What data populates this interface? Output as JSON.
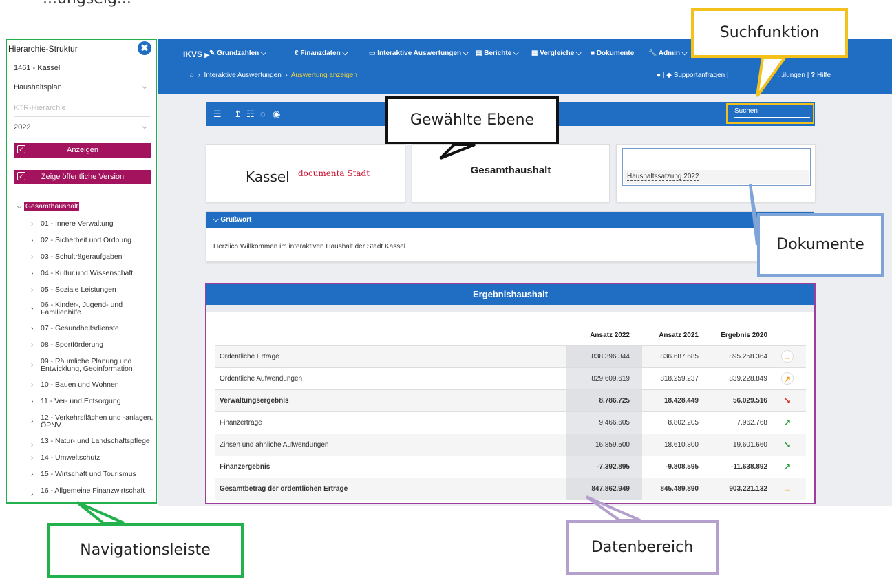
{
  "top_text": "...ungseig...",
  "nav": {
    "title": "Hierarchie-Struktur",
    "close_icon": "close-icon",
    "location": "1461 - Kassel",
    "plan_select": "Haushaltsplan",
    "ktr_placeholder": "KTR-Hierarchie",
    "year_select": "2022",
    "show_button": "Anzeigen",
    "public_button": "Zeige öffentliche Version",
    "tree_root": "Gesamthaushalt",
    "tree_items": [
      "01 - Innere Verwaltung",
      "02 - Sicherheit und Ordnung",
      "03 - Schulträgeraufgaben",
      "04 - Kultur und Wissenschaft",
      "05 - Soziale Leistungen",
      "06 - Kinder-, Jugend- und Familienhilfe",
      "07 - Gesundheitsdienste",
      "08 - Sportförderung",
      "09 - Räumliche Planung und Entwicklung, Geoinformation",
      "10 - Bauen und Wohnen",
      "11 - Ver- und Entsorgung",
      "12 - Verkehrsflächen und -anlagen, ÖPNV",
      "13 - Natur- und Landschaftspflege",
      "14 - Umweltschutz",
      "15 - Wirtschaft und Tourismus",
      "16 - Allgemeine Finanzwirtschaft"
    ]
  },
  "header": {
    "logo": "IKVS",
    "menu": [
      "Grundzahlen",
      "Finanzdaten",
      "Interaktive Auswertungen",
      "Berichte",
      "Vergleiche",
      "Dokumente",
      "Admin"
    ],
    "breadcrumb": [
      "Interaktive Auswertungen",
      "Auswertung anzeigen"
    ],
    "right_links": [
      "Supportanfragen",
      "...ilungen",
      "Hilfe"
    ],
    "search_placeholder": "Suchen"
  },
  "cards": {
    "city": "Kassel",
    "city_tagline": "documenta Stadt",
    "level": "Gesamthaushalt",
    "document_link": "Haushaltssatzung 2022"
  },
  "greeting": {
    "title": "Grußwort",
    "text": "Herzlich Willkommen im interaktiven Haushalt der Stadt Kassel"
  },
  "results": {
    "title": "Ergebnishaushalt",
    "columns": [
      "Ansatz 2022",
      "Ansatz 2021",
      "Ergebnis 2020"
    ],
    "rows": [
      {
        "label": "Ordentliche Erträge",
        "v1": "838.396.344",
        "v2": "836.687.685",
        "v3": "895.258.364",
        "trend": "→",
        "color": "#f39c12",
        "link": true,
        "bold": false,
        "circle": true
      },
      {
        "label": "Ordentliche Aufwendungen",
        "v1": "829.609.619",
        "v2": "818.259.237",
        "v3": "839.228.849",
        "trend": "↗",
        "color": "#f39c12",
        "link": true,
        "bold": false,
        "circle": true
      },
      {
        "label": "Verwaltungsergebnis",
        "v1": "8.786.725",
        "v2": "18.428.449",
        "v3": "56.029.516",
        "trend": "↘",
        "color": "#d9261c",
        "link": false,
        "bold": true,
        "circle": false
      },
      {
        "label": "Finanzerträge",
        "v1": "9.466.605",
        "v2": "8.802.205",
        "v3": "7.962.768",
        "trend": "↗",
        "color": "#2e9e3e",
        "link": false,
        "bold": false,
        "circle": false
      },
      {
        "label": "Zinsen und ähnliche Aufwendungen",
        "v1": "16.859.500",
        "v2": "18.610.800",
        "v3": "19.601.660",
        "trend": "↘",
        "color": "#2e9e3e",
        "link": false,
        "bold": false,
        "circle": false
      },
      {
        "label": "Finanzergebnis",
        "v1": "-7.392.895",
        "v2": "-9.808.595",
        "v3": "-11.638.892",
        "trend": "↗",
        "color": "#2e9e3e",
        "link": false,
        "bold": true,
        "circle": false
      },
      {
        "label": "Gesamtbetrag der ordentlichen Erträge",
        "v1": "847.862.949",
        "v2": "845.489.890",
        "v3": "903.221.132",
        "trend": "→",
        "color": "#f39c12",
        "link": false,
        "bold": true,
        "circle": false
      }
    ]
  },
  "callouts": {
    "search": "Suchfunktion",
    "level": "Gewählte Ebene",
    "documents": "Dokumente",
    "navigation": "Navigationsleiste",
    "data": "Datenbereich"
  }
}
